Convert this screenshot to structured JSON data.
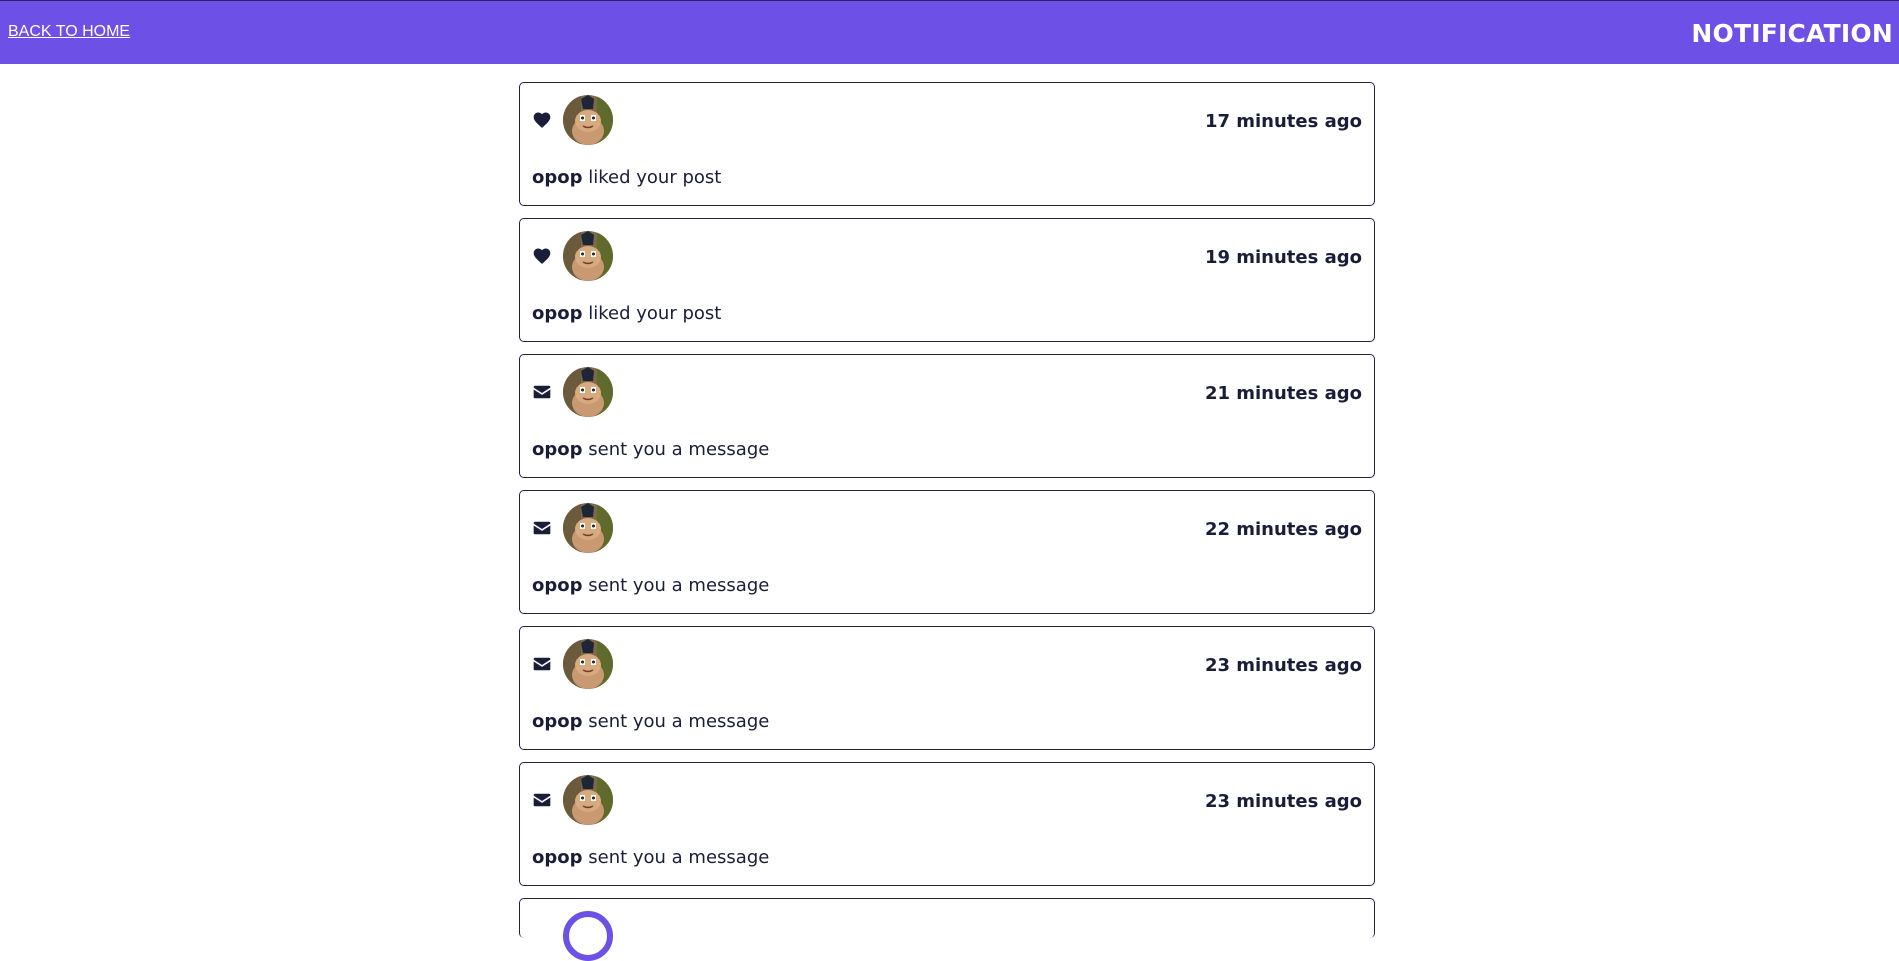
{
  "header": {
    "back_label": "BACK TO HOME",
    "title": "NOTIFICATION",
    "bg_color": "#6d50e6"
  },
  "notifications": [
    {
      "icon": "heart-icon",
      "user": "opop",
      "text": "liked your post",
      "time": "17 minutes ago"
    },
    {
      "icon": "heart-icon",
      "user": "opop",
      "text": "liked your post",
      "time": "19 minutes ago"
    },
    {
      "icon": "envelope-icon",
      "user": "opop",
      "text": "sent you a message",
      "time": "21 minutes ago"
    },
    {
      "icon": "envelope-icon",
      "user": "opop",
      "text": "sent you a message",
      "time": "22 minutes ago"
    },
    {
      "icon": "envelope-icon",
      "user": "opop",
      "text": "sent you a message",
      "time": "23 minutes ago"
    },
    {
      "icon": "envelope-icon",
      "user": "opop",
      "text": "sent you a message",
      "time": "23 minutes ago"
    }
  ]
}
